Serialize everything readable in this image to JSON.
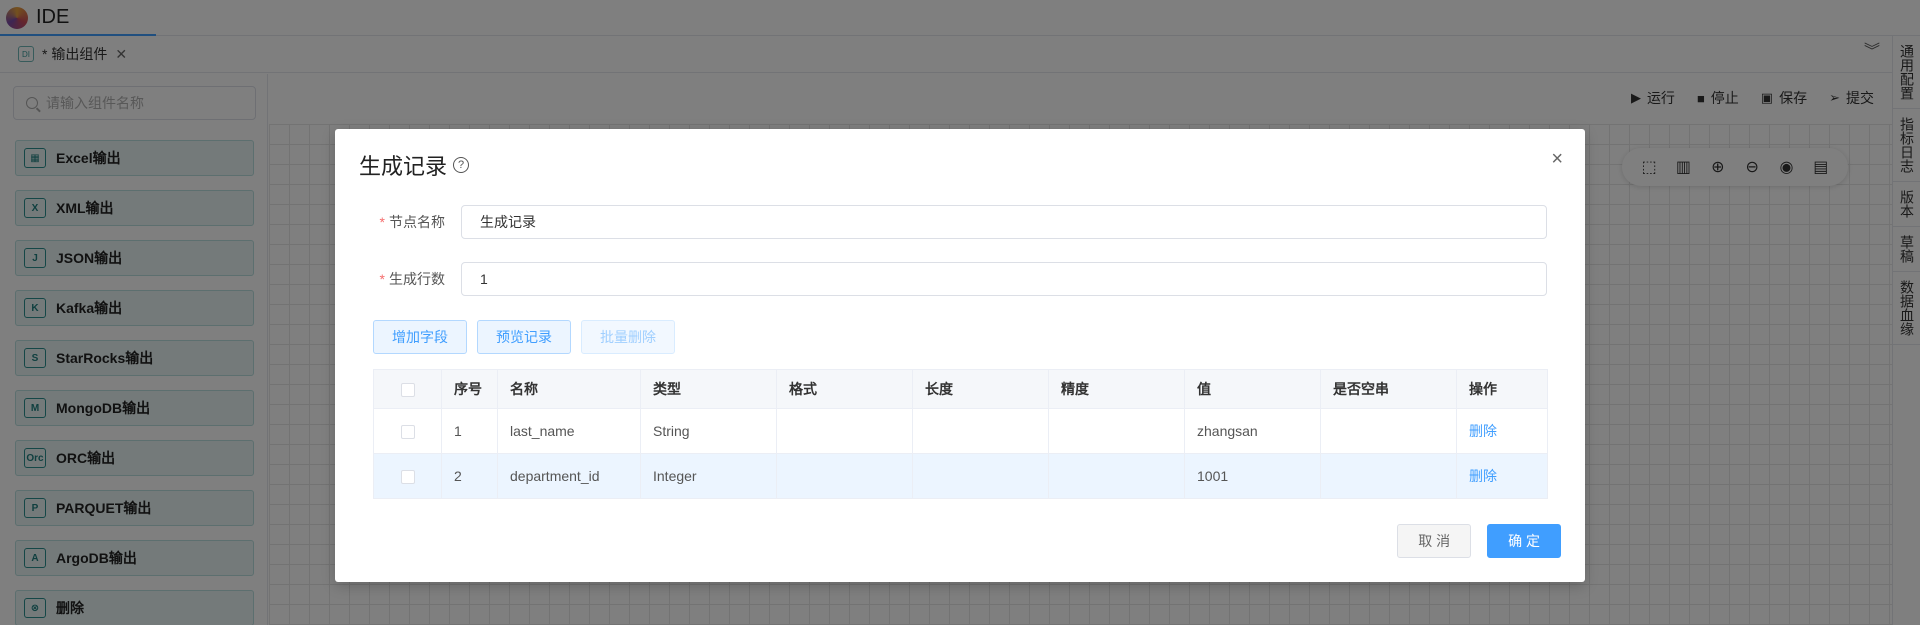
{
  "app": {
    "title": "IDE"
  },
  "tab": {
    "type_icon": "DI",
    "label": "* 输出组件",
    "close": "✕"
  },
  "collapse_icon": "︾",
  "sidebar": {
    "search_placeholder": "请输入组件名称",
    "items": [
      {
        "icon": "▦",
        "label": "Excel输出"
      },
      {
        "icon": "X",
        "label": "XML输出"
      },
      {
        "icon": "J",
        "label": "JSON输出"
      },
      {
        "icon": "K",
        "label": "Kafka输出"
      },
      {
        "icon": "S",
        "label": "StarRocks输出"
      },
      {
        "icon": "M",
        "label": "MongoDB输出"
      },
      {
        "icon": "Orc",
        "label": "ORC输出"
      },
      {
        "icon": "P",
        "label": "PARQUET输出"
      },
      {
        "icon": "A",
        "label": "ArgoDB输出"
      },
      {
        "icon": "⊗",
        "label": "删除"
      }
    ],
    "collapse_arrow": "‹"
  },
  "toolbar": {
    "run": "运行",
    "stop": "停止",
    "save": "保存",
    "submit": "提交"
  },
  "right_rail": [
    "通用配置",
    "指标日志",
    "版本",
    "草稿",
    "数据血缘"
  ],
  "modal": {
    "title": "生成记录",
    "help": "?",
    "close": "×",
    "fields": {
      "node_name_label": "节点名称",
      "node_name_value": "生成记录",
      "rows_label": "生成行数",
      "rows_value": "1",
      "required_mark": "*"
    },
    "buttons": {
      "add_field": "增加字段",
      "preview": "预览记录",
      "batch_delete": "批量删除"
    },
    "table": {
      "headers": [
        "序号",
        "名称",
        "类型",
        "格式",
        "长度",
        "精度",
        "值",
        "是否空串",
        "操作"
      ],
      "rows": [
        {
          "index": "1",
          "name": "last_name",
          "type": "String",
          "format": "",
          "length": "",
          "precision": "",
          "value": "zhangsan",
          "empty_string": "",
          "action": "删除"
        },
        {
          "index": "2",
          "name": "department_id",
          "type": "Integer",
          "format": "",
          "length": "",
          "precision": "",
          "value": "1001",
          "empty_string": "",
          "action": "删除"
        }
      ]
    },
    "footer": {
      "cancel": "取 消",
      "confirm": "确 定"
    }
  }
}
